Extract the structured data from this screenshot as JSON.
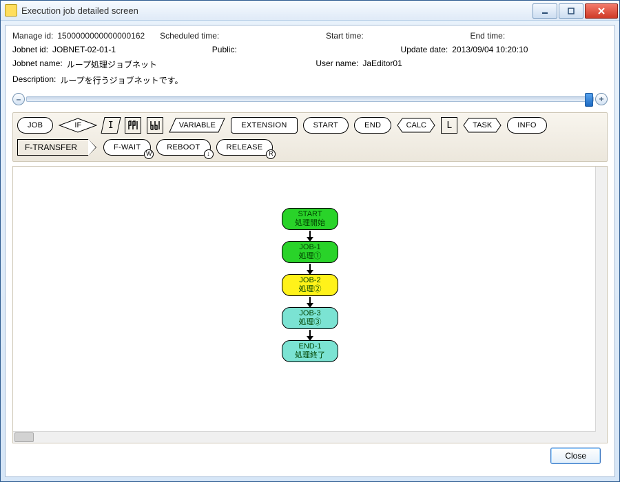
{
  "window": {
    "title": "Execution job detailed screen"
  },
  "meta": {
    "manage_id": {
      "label": "Manage id:",
      "value": "1500000000000000162"
    },
    "scheduled_time": {
      "label": "Scheduled time:",
      "value": ""
    },
    "start_time": {
      "label": "Start time:",
      "value": ""
    },
    "end_time": {
      "label": "End time:",
      "value": ""
    },
    "jobnet_id": {
      "label": "Jobnet id:",
      "value": "JOBNET-02-01-1"
    },
    "public_": {
      "label": "Public:",
      "value": ""
    },
    "update_date": {
      "label": "Update date:",
      "value": "2013/09/04 10:20:10"
    },
    "jobnet_name": {
      "label": "Jobnet name:",
      "value": "ループ処理ジョブネット"
    },
    "user_name": {
      "label": "User name:",
      "value": "JaEditor01"
    },
    "description": {
      "label": "Description:",
      "value": "ループを行うジョブネットです。"
    }
  },
  "toolbar": {
    "job": "JOB",
    "if": "IF",
    "i": "I",
    "m1": "m",
    "m2": "m",
    "variable": "VARIABLE",
    "extension": "EXTENSION",
    "start": "START",
    "end": "END",
    "calc": "CALC",
    "l": "L",
    "task": "TASK",
    "info": "INFO",
    "ftransfer": "F-TRANSFER",
    "fwait": "F-WAIT",
    "reboot": "REBOOT",
    "release": "RELEASE",
    "fwait_badge": "W",
    "reboot_badge": "↓",
    "release_badge": "R"
  },
  "flow": [
    {
      "id": "start",
      "title": "START",
      "sub": "処理開始",
      "color": "green"
    },
    {
      "id": "job1",
      "title": "JOB-1",
      "sub": "処理①",
      "color": "green"
    },
    {
      "id": "job2",
      "title": "JOB-2",
      "sub": "処理②",
      "color": "yellow"
    },
    {
      "id": "job3",
      "title": "JOB-3",
      "sub": "処理③",
      "color": "cyan"
    },
    {
      "id": "end1",
      "title": "END-1",
      "sub": "処理終了",
      "color": "cyan"
    }
  ],
  "footer": {
    "close": "Close"
  },
  "slider": {
    "minus": "–",
    "plus": "+"
  }
}
